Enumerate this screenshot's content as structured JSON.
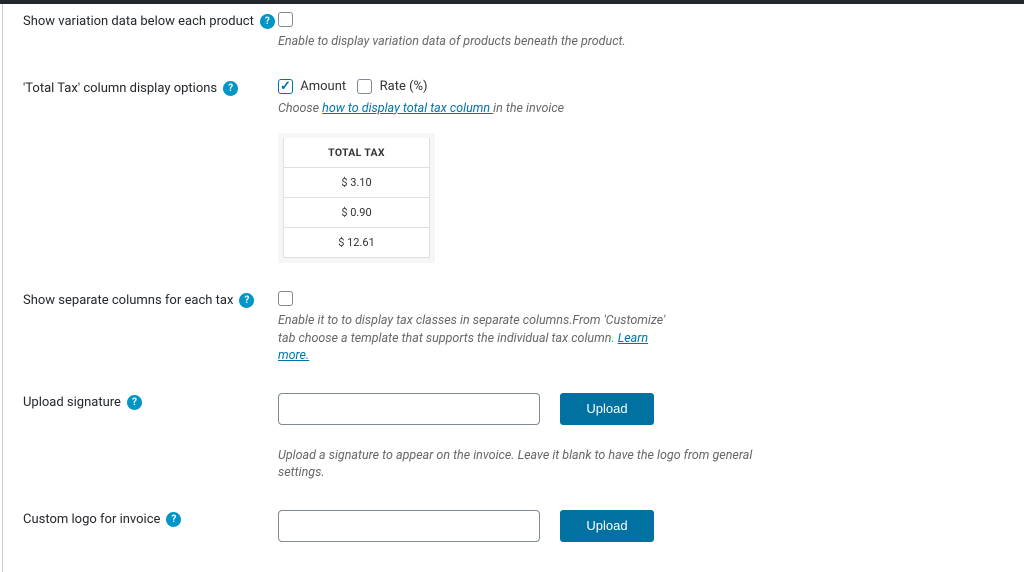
{
  "colors": {
    "accent": "#0071a1",
    "help": "#0196c7",
    "link": "#0073aa"
  },
  "rows": {
    "variation_data": {
      "label": "Show variation data below each product",
      "checked": false,
      "desc": "Enable to display variation data of products beneath the product."
    },
    "total_tax": {
      "label": "'Total Tax' column display options",
      "amount": {
        "label": "Amount",
        "checked": true
      },
      "rate": {
        "label": "Rate (%)",
        "checked": false
      },
      "desc_pre": "Choose ",
      "desc_link": "how to display total tax column ",
      "desc_post": "in the invoice",
      "preview": {
        "header": "TOTAL TAX",
        "rows": [
          "$ 3.10",
          "$ 0.90",
          "$ 12.61"
        ]
      }
    },
    "separate_cols": {
      "label": "Show separate columns for each tax",
      "checked": false,
      "desc_pre": "Enable it to to display tax classes in separate columns.From 'Customize' tab choose a template that supports the individual tax column. ",
      "desc_link": "Learn more."
    },
    "signature": {
      "label": "Upload signature",
      "value": "",
      "button": "Upload",
      "desc": "Upload a signature to appear on the invoice. Leave it blank to have the logo from general settings."
    },
    "custom_logo": {
      "label": "Custom logo for invoice",
      "value": "",
      "button": "Upload"
    }
  },
  "glyphs": {
    "help": "?"
  }
}
